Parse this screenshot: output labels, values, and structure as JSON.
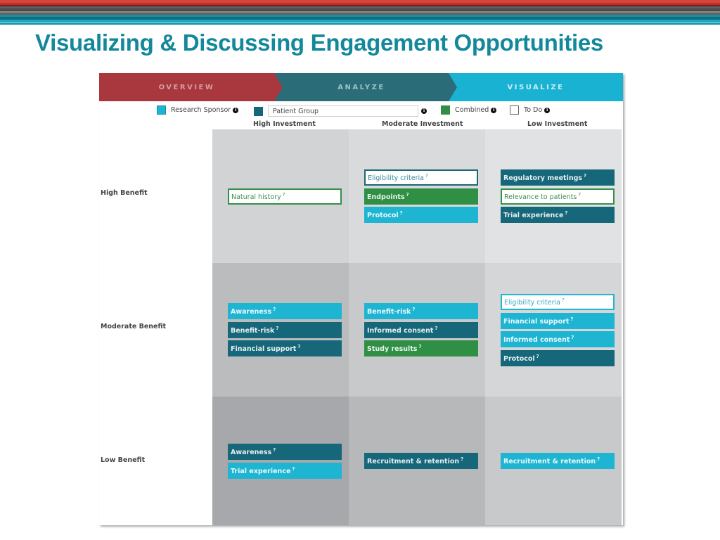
{
  "slide": {
    "title": "Visualizing & Discussing Engagement Opportunities",
    "title_color": "#13889b",
    "stripe_colors": [
      "#d9443a",
      "#b8302c",
      "#7a1b1b",
      "#5e5e5e",
      "#4b4b4b",
      "#8a8a88",
      "#636363",
      "#1b8ea3",
      "#0f6f82",
      "#23a3bd",
      "#57c1d3",
      "#1396ad",
      "#e4e4e4"
    ]
  },
  "steps": [
    {
      "label": "OVERVIEW",
      "color": "#a8373e"
    },
    {
      "label": "ANALYZE",
      "color": "#2a6c77"
    },
    {
      "label": "VISUALIZE",
      "color": "#1ab2d2",
      "active": true
    }
  ],
  "legend": {
    "research_sponsor": {
      "label": "Research Sponsor",
      "color": "#1eb5d3",
      "info_icon": "info-icon"
    },
    "patient_group": {
      "input_value": "Patient Group",
      "color": "#16677a",
      "info_icon": "info-icon"
    },
    "combined": {
      "label": "Combined",
      "color": "#2f8f45",
      "info_icon": "info-icon"
    },
    "to_do": {
      "label": "To Do",
      "color": "#ffffff",
      "info_icon": "info-icon"
    }
  },
  "columns": [
    "High Investment",
    "Moderate Investment",
    "Low Investment"
  ],
  "rows": [
    "High Benefit",
    "Moderate Benefit",
    "Low Benefit"
  ],
  "help_marker": "?",
  "cells": {
    "high_high": [
      {
        "label": "Natural history",
        "type": "todo-green"
      }
    ],
    "high_moderate": [
      {
        "label": "Eligibility criteria",
        "type": "todo-teal"
      },
      {
        "label": "Endpoints",
        "type": "combined"
      },
      {
        "label": "Protocol",
        "type": "sponsor"
      }
    ],
    "high_low": [
      {
        "label": "Regulatory meetings",
        "type": "patient"
      },
      {
        "label": "Relevance to patients",
        "type": "todo-green"
      },
      {
        "label": "Trial experience",
        "type": "patient"
      }
    ],
    "moderate_high": [
      {
        "label": "Awareness",
        "type": "sponsor"
      },
      {
        "label": "Benefit-risk",
        "type": "patient"
      },
      {
        "label": "Financial support",
        "type": "patient"
      }
    ],
    "moderate_moderate": [
      {
        "label": "Benefit-risk",
        "type": "sponsor"
      },
      {
        "label": "Informed consent",
        "type": "patient"
      },
      {
        "label": "Study results",
        "type": "combined"
      }
    ],
    "moderate_low": [
      {
        "label": "Eligibility criteria",
        "type": "todo-cyan"
      },
      {
        "label": "Financial support",
        "type": "sponsor"
      },
      {
        "label": "Informed consent",
        "type": "sponsor"
      },
      {
        "label": "Protocol",
        "type": "patient"
      }
    ],
    "low_high": [
      {
        "label": "Awareness",
        "type": "patient"
      },
      {
        "label": "Trial experience",
        "type": "sponsor"
      }
    ],
    "low_moderate": [
      {
        "label": "Recruitment & retention",
        "type": "patient"
      }
    ],
    "low_low": [
      {
        "label": "Recruitment & retention",
        "type": "sponsor"
      }
    ]
  }
}
